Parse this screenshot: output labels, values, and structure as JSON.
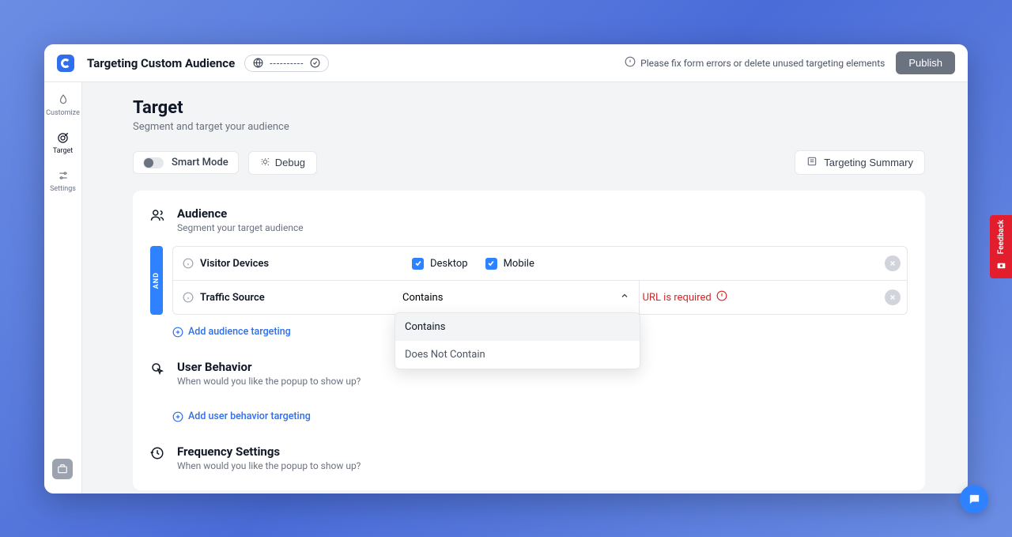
{
  "header": {
    "title": "Targeting Custom Audience",
    "url_placeholder": "----------",
    "warning": "Please fix form errors or delete unused targeting elements",
    "publish": "Publish"
  },
  "sidebar": {
    "customize": "Customize",
    "target": "Target",
    "settings": "Settings"
  },
  "page": {
    "heading": "Target",
    "subtitle": "Segment and target your audience"
  },
  "controls": {
    "smart_mode": "Smart Mode",
    "debug": "Debug",
    "summary": "Targeting Summary"
  },
  "audience": {
    "title": "Audience",
    "subtitle": "Segment your target audience",
    "and": "AND",
    "visitor_devices": "Visitor Devices",
    "desktop": "Desktop",
    "mobile": "Mobile",
    "traffic_source": "Traffic Source",
    "select_value": "Contains",
    "select_options": {
      "contains": "Contains",
      "does_not_contain": "Does Not Contain"
    },
    "error": "URL is required",
    "add": "Add audience targeting"
  },
  "behavior": {
    "title": "User Behavior",
    "subtitle": "When would you like the popup to show up?",
    "add": "Add user behavior targeting"
  },
  "frequency": {
    "title": "Frequency Settings",
    "subtitle": "When would you like the popup to show up?"
  },
  "feedback": "Feedback"
}
